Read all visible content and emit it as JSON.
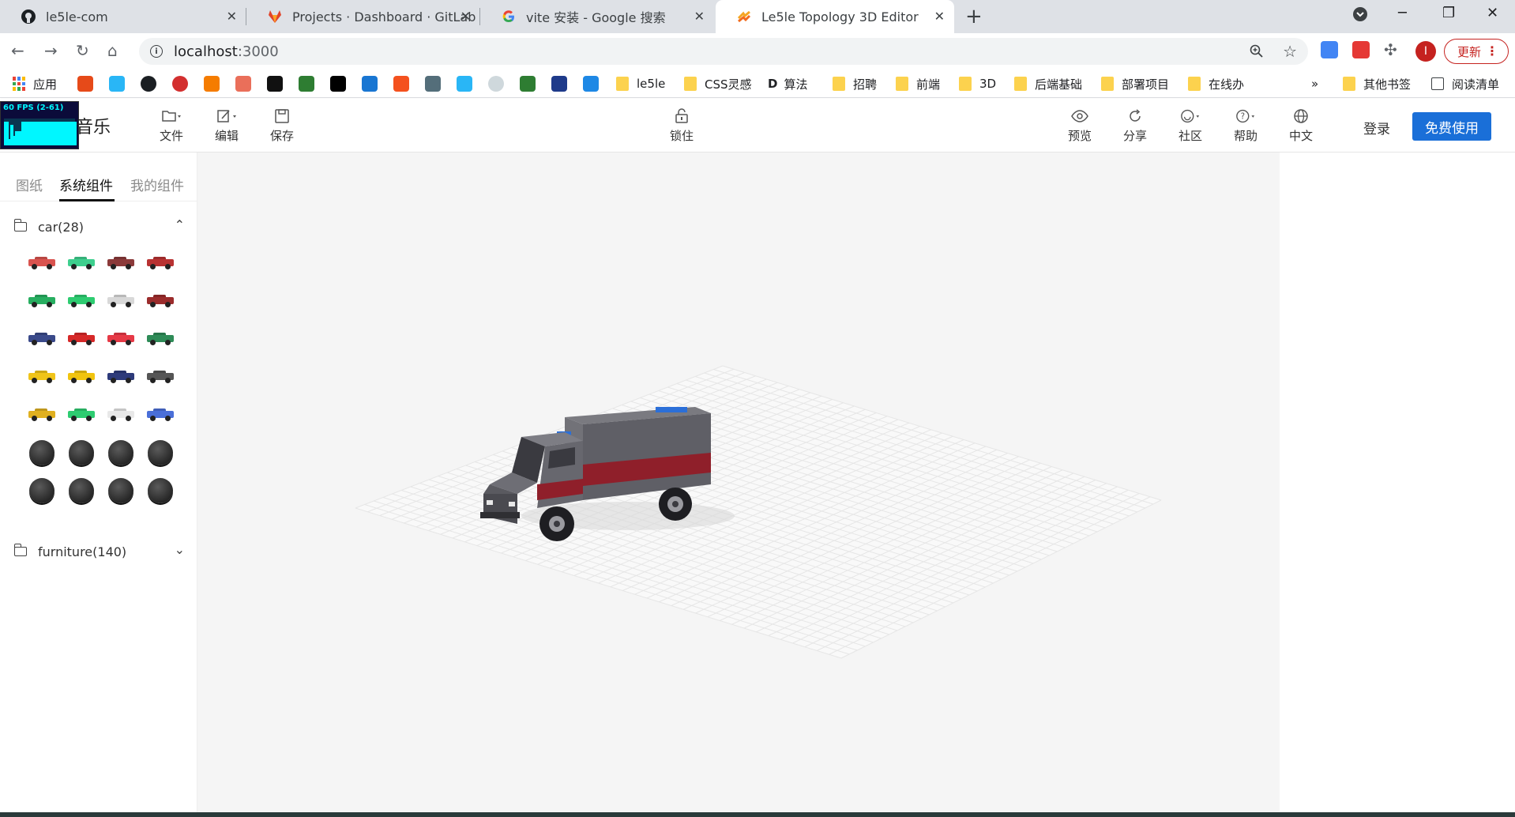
{
  "browser": {
    "tabs": [
      {
        "title": "le5le-com",
        "icon": "github-icon"
      },
      {
        "title": "Projects · Dashboard · GitLab",
        "icon": "gitlab-icon"
      },
      {
        "title": "vite 安装 - Google 搜索",
        "icon": "google-icon"
      },
      {
        "title": "Le5le Topology 3D Editor",
        "icon": "le5le-icon",
        "active": true
      }
    ],
    "url_host": "localhost",
    "url_port": ":3000",
    "update_label": "更新",
    "profile_initial": "I",
    "bookmarks": {
      "apps": "应用",
      "folders": [
        "le5le",
        "CSS灵感",
        "算法",
        "招聘",
        "前端",
        "3D",
        "后端基础",
        "部署项目",
        "在线办"
      ],
      "more": "»",
      "other": "其他书签",
      "reading_list": "阅读清单"
    }
  },
  "app": {
    "fps_label": "60 FPS (2-61)",
    "brand": "音乐",
    "toolbar_left": [
      {
        "label": "文件",
        "icon": "folder-icon"
      },
      {
        "label": "编辑",
        "icon": "edit-icon"
      },
      {
        "label": "保存",
        "icon": "save-icon"
      }
    ],
    "lock_label": "锁住",
    "toolbar_right": [
      {
        "label": "预览",
        "icon": "eye-icon"
      },
      {
        "label": "分享",
        "icon": "share-icon"
      },
      {
        "label": "社区",
        "icon": "smile-icon"
      },
      {
        "label": "帮助",
        "icon": "help-icon"
      },
      {
        "label": "中文",
        "icon": "globe-icon"
      }
    ],
    "login_label": "登录",
    "free_label": "免费使用"
  },
  "sidebar": {
    "tabs": [
      "图纸",
      "系统组件",
      "我的组件"
    ],
    "active_tab": "系统组件",
    "categories": [
      {
        "label": "car(28)",
        "expanded": true
      },
      {
        "label": "furniture(140)",
        "expanded": false
      }
    ],
    "car_items": [
      {
        "color": "#d9534f"
      },
      {
        "color": "#3ecf8e"
      },
      {
        "color": "#8b3a3a"
      },
      {
        "color": "#b83232"
      },
      {
        "color": "#27ae60"
      },
      {
        "color": "#2ecc71"
      },
      {
        "color": "#d8d8d8"
      },
      {
        "color": "#9b2c2c"
      },
      {
        "color": "#3a4a8a"
      },
      {
        "color": "#d62828"
      },
      {
        "color": "#e63946"
      },
      {
        "color": "#2e8b57"
      },
      {
        "color": "#f0c419"
      },
      {
        "color": "#f1c40f"
      },
      {
        "color": "#2d3a7a"
      },
      {
        "color": "#555555"
      },
      {
        "color": "#e0b020"
      },
      {
        "color": "#2ecc71"
      },
      {
        "color": "#e8e8e8"
      },
      {
        "color": "#4a6fd8"
      },
      {
        "color": "puck"
      },
      {
        "color": "puck"
      },
      {
        "color": "puck"
      },
      {
        "color": "puck"
      },
      {
        "color": "puck"
      },
      {
        "color": "puck"
      },
      {
        "color": "puck"
      },
      {
        "color": "puck"
      }
    ]
  },
  "scene": {
    "model": "ambulance",
    "colors": {
      "body": "#6b6b70",
      "stripe": "#8f1f2a",
      "light": "#2b6fd8",
      "grid": "#e6e6e6"
    }
  }
}
